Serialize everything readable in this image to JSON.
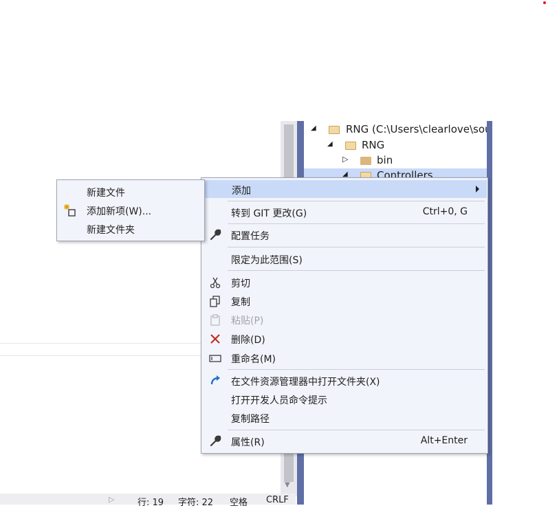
{
  "status_bar": {
    "line": "行: 19",
    "char": "字符: 22",
    "spacing": "空格",
    "line_ending": "CRLF"
  },
  "solution_explorer": {
    "items": [
      {
        "label": "RNG (C:\\Users\\clearlove\\source",
        "icon": "folder-icon",
        "expanded": true
      },
      {
        "label": "RNG",
        "icon": "folder-icon",
        "expanded": true
      },
      {
        "label": "bin",
        "icon": "folder-icon",
        "expanded": false
      },
      {
        "label": "Controllers",
        "icon": "folder-icon",
        "expanded": true,
        "selected": true
      }
    ]
  },
  "context_menu": {
    "items": [
      {
        "label": "添加",
        "has_submenu": true,
        "highlighted": true
      },
      {
        "label": "转到 GIT 更改(G)",
        "shortcut": "Ctrl+0, G"
      },
      {
        "label": "配置任务",
        "icon": "wrench-icon"
      },
      {
        "label": "限定为此范围(S)"
      },
      {
        "label": "剪切",
        "icon": "scissors-icon"
      },
      {
        "label": "复制",
        "icon": "copy-icon"
      },
      {
        "label": "粘贴(P)",
        "icon": "paste-icon",
        "disabled": true
      },
      {
        "label": "删除(D)",
        "icon": "delete-icon"
      },
      {
        "label": "重命名(M)",
        "icon": "rename-icon"
      },
      {
        "label": "在文件资源管理器中打开文件夹(X)",
        "icon": "open-folder-icon"
      },
      {
        "label": "打开开发人员命令提示"
      },
      {
        "label": "复制路径"
      },
      {
        "label": "属性(R)",
        "icon": "wrench-icon",
        "shortcut": "Alt+Enter"
      }
    ]
  },
  "add_submenu": {
    "items": [
      {
        "label": "新建文件"
      },
      {
        "label": "添加新项(W)...",
        "icon": "new-item-icon"
      },
      {
        "label": "新建文件夹"
      }
    ]
  },
  "colors": {
    "menu_background": "#f2f4fb",
    "highlight": "#c9daf8",
    "panel_border": "#5f6fa6",
    "delete_red": "#c42b1c",
    "open_blue": "#1e6fd0"
  }
}
